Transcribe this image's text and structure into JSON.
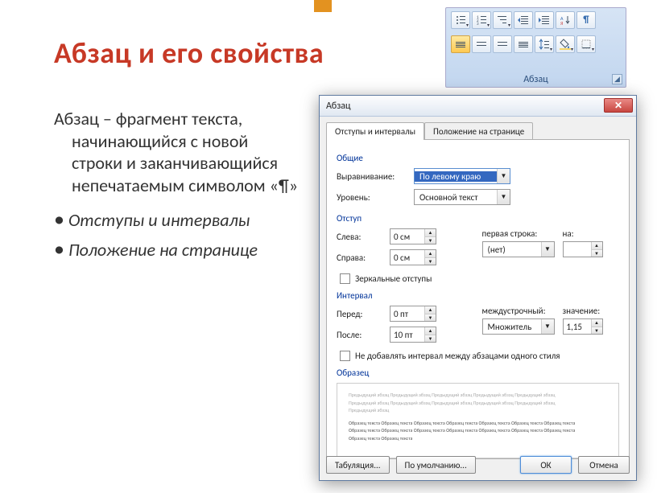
{
  "slide": {
    "title": "Абзац и его свойства",
    "definition_lead": "Абзац – фрагмент текста,",
    "definition_rest": "начинающийся с новой строки и заканчивающийся непечатаемым символом «¶»",
    "bullet1": "Отступы и интервалы",
    "bullet2": "Положение на странице"
  },
  "ribbon": {
    "group_label": "Абзац"
  },
  "dialog": {
    "title": "Абзац",
    "close": "✕",
    "tabs": {
      "indents": "Отступы и интервалы",
      "position": "Положение на странице"
    },
    "general": {
      "group": "Общие",
      "alignment_label": "Выравнивание:",
      "alignment_value": "По левому краю",
      "level_label": "Уровень:",
      "level_value": "Основной текст"
    },
    "indent": {
      "group": "Отступ",
      "left_label": "Слева:",
      "left_value": "0 см",
      "right_label": "Справа:",
      "right_value": "0 см",
      "first_label": "первая строка:",
      "first_value": "(нет)",
      "by_label": "на:",
      "by_value": "",
      "mirror": "Зеркальные отступы"
    },
    "spacing": {
      "group": "Интервал",
      "before_label": "Перед:",
      "before_value": "0 пт",
      "after_label": "После:",
      "after_value": "10 пт",
      "line_label": "междустрочный:",
      "line_value": "Множитель",
      "at_label": "значение:",
      "at_value": "1,15",
      "nosame": "Не добавлять интервал между абзацами одного стиля"
    },
    "preview_label": "Образец",
    "buttons": {
      "tabs": "Табуляция...",
      "default": "По умолчанию...",
      "ok": "ОК",
      "cancel": "Отмена"
    }
  }
}
